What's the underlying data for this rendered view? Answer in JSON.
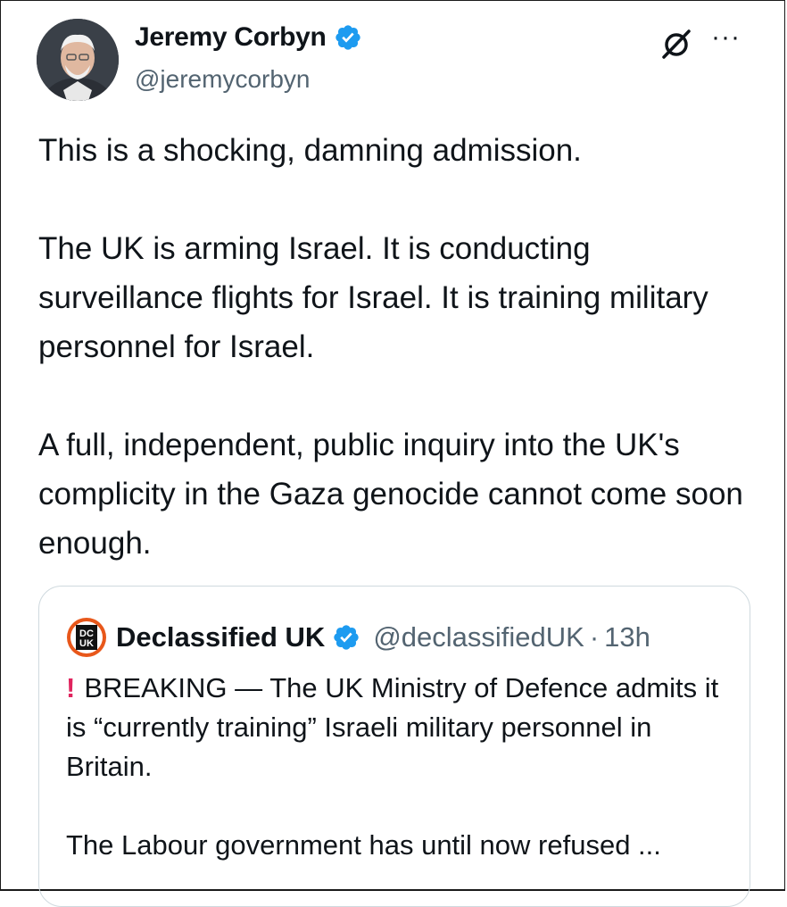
{
  "author": {
    "name": "Jeremy Corbyn",
    "handle": "@jeremycorbyn"
  },
  "icons": {
    "verified": "verified-badge-icon",
    "grok": "grok-icon",
    "more": "more-options-icon",
    "more_glyph": "···"
  },
  "tweet": {
    "paragraphs": [
      "This is a shocking, damning admission.",
      "The UK is arming Israel. It is conducting surveillance flights for Israel. It is training military personnel for Israel.",
      "A full, independent, public inquiry into the UK's complicity in the Gaza genocide cannot come soon enough."
    ]
  },
  "quote": {
    "logo_text_top": "DC",
    "logo_text_bottom": "UK",
    "name": "Declassified UK",
    "handle": "@declassifiedUK",
    "separator": "·",
    "time": "13h",
    "exclamation": "!",
    "line1": "BREAKING — The UK Ministry of Defence admits it is “currently training” Israeli military personnel in Britain.",
    "line2": "The Labour government has until now refused ..."
  },
  "colors": {
    "verified_blue": "#1d9bf0",
    "text": "#0f1419",
    "secondary_text": "#536471",
    "border": "#cfd9de",
    "exclamation_red": "#e0245e"
  }
}
